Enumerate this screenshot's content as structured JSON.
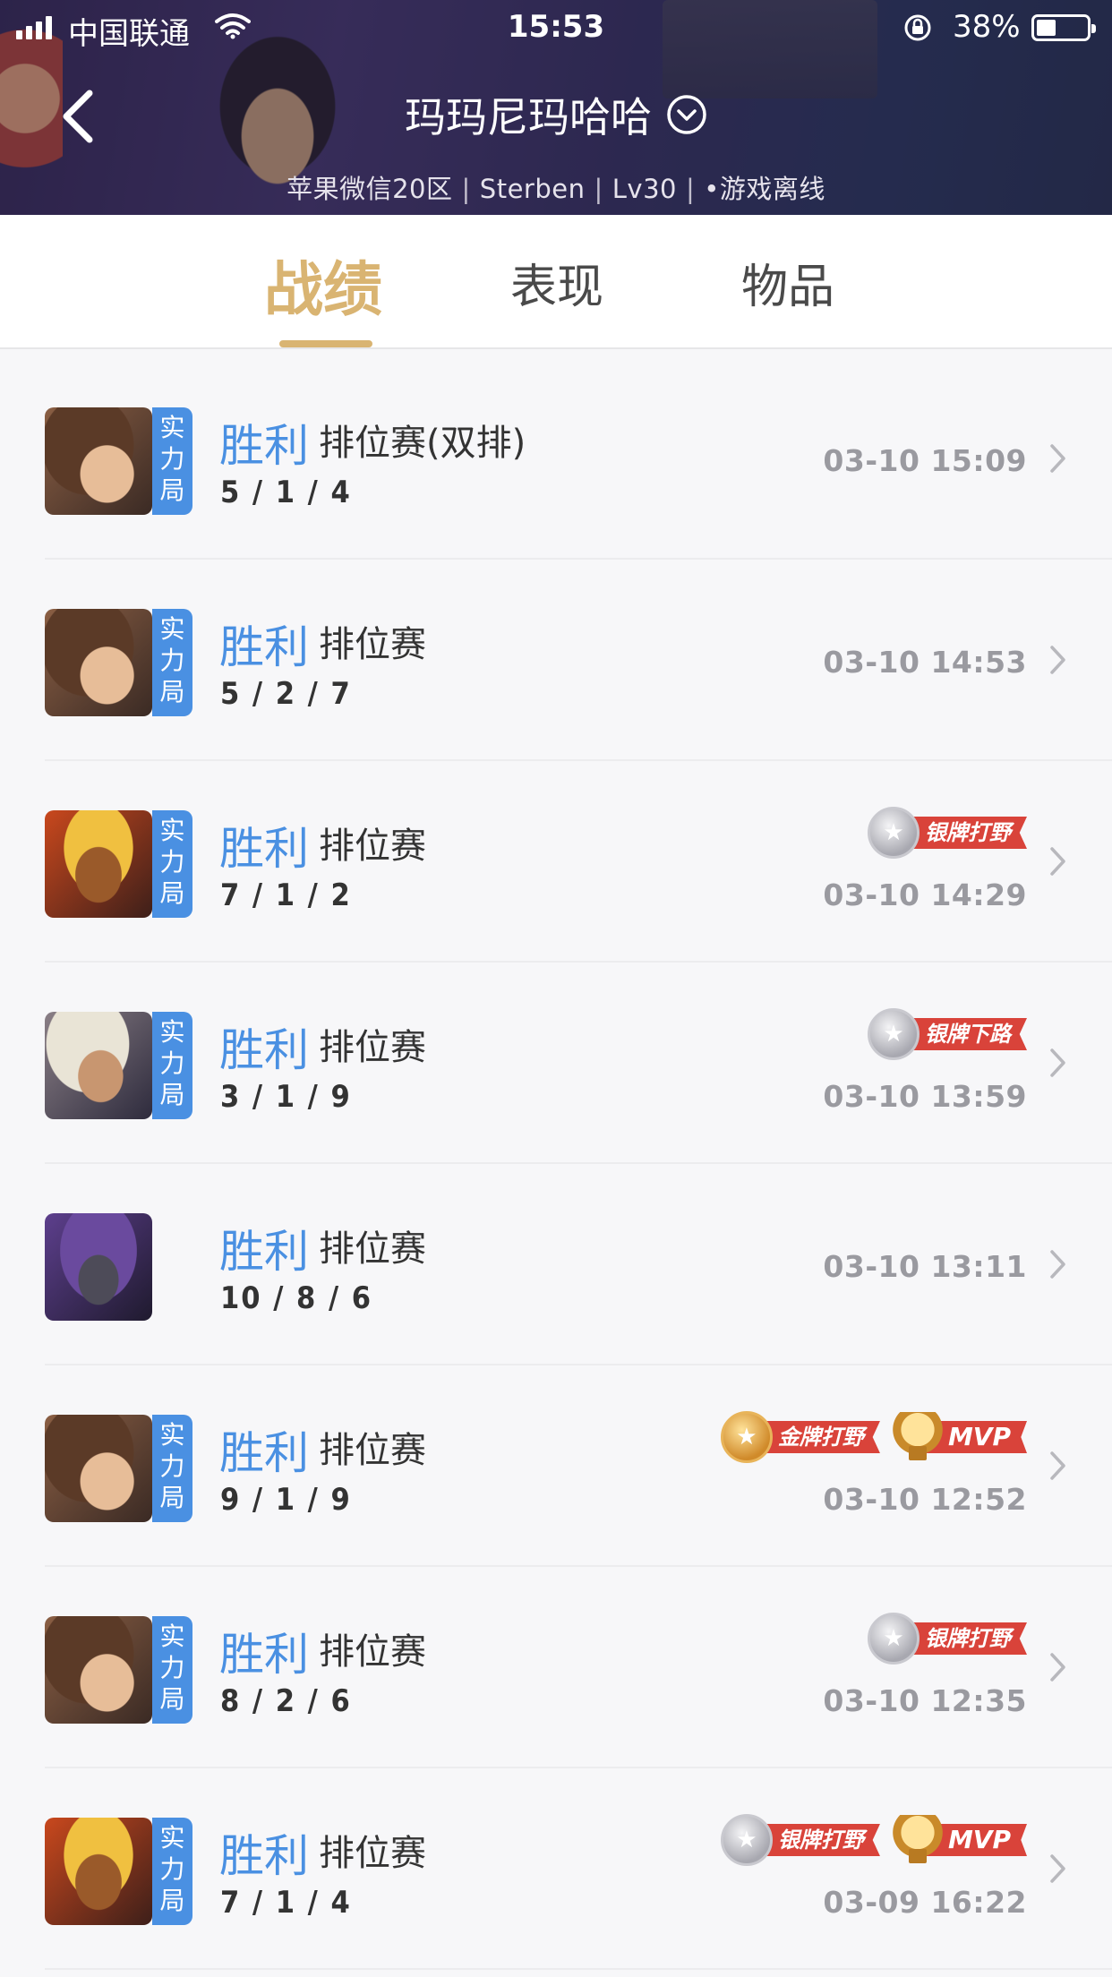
{
  "status_bar": {
    "carrier": "中国联通",
    "time": "15:53",
    "battery": "38%",
    "battery_level": 0.38
  },
  "header": {
    "player_name": "玛玛尼玛哈哈",
    "server": "苹果微信20区",
    "account": "Sterben",
    "level": "Lv30",
    "status": "•游戏离线"
  },
  "tabs": [
    {
      "label": "战绩",
      "active": true
    },
    {
      "label": "表现",
      "active": false
    },
    {
      "label": "物品",
      "active": false
    }
  ],
  "mode_tag": [
    "实",
    "力",
    "局"
  ],
  "matches": [
    {
      "result": "胜利",
      "type": "排位赛(双排)",
      "kda": "5 / 1 / 4",
      "time": "03-10 15:09",
      "hero": "a",
      "ranked_tag": true,
      "badges": []
    },
    {
      "result": "胜利",
      "type": "排位赛",
      "kda": "5 / 2 / 7",
      "time": "03-10 14:53",
      "hero": "a",
      "ranked_tag": true,
      "badges": []
    },
    {
      "result": "胜利",
      "type": "排位赛",
      "kda": "7 / 1 / 2",
      "time": "03-10 14:29",
      "hero": "b",
      "ranked_tag": true,
      "badges": [
        {
          "kind": "silver",
          "label": "银牌打野"
        }
      ]
    },
    {
      "result": "胜利",
      "type": "排位赛",
      "kda": "3 / 1 / 9",
      "time": "03-10 13:59",
      "hero": "c",
      "ranked_tag": true,
      "badges": [
        {
          "kind": "silver",
          "label": "银牌下路"
        }
      ]
    },
    {
      "result": "胜利",
      "type": "排位赛",
      "kda": "10 / 8 / 6",
      "time": "03-10 13:11",
      "hero": "d",
      "ranked_tag": false,
      "badges": []
    },
    {
      "result": "胜利",
      "type": "排位赛",
      "kda": "9 / 1 / 9",
      "time": "03-10 12:52",
      "hero": "a",
      "ranked_tag": true,
      "badges": [
        {
          "kind": "gold",
          "label": "金牌打野"
        },
        {
          "kind": "mvp",
          "label": "MVP"
        }
      ]
    },
    {
      "result": "胜利",
      "type": "排位赛",
      "kda": "8 / 2 / 6",
      "time": "03-10 12:35",
      "hero": "a",
      "ranked_tag": true,
      "badges": [
        {
          "kind": "silver",
          "label": "银牌打野"
        }
      ]
    },
    {
      "result": "胜利",
      "type": "排位赛",
      "kda": "7 / 1 / 4",
      "time": "03-09 16:22",
      "hero": "b",
      "ranked_tag": true,
      "badges": [
        {
          "kind": "silver",
          "label": "银牌打野"
        },
        {
          "kind": "mvp",
          "label": "MVP"
        }
      ]
    }
  ],
  "colors": {
    "accent_gold": "#d9b472",
    "win_blue": "#4a90e2",
    "badge_red": "#d9433a"
  }
}
